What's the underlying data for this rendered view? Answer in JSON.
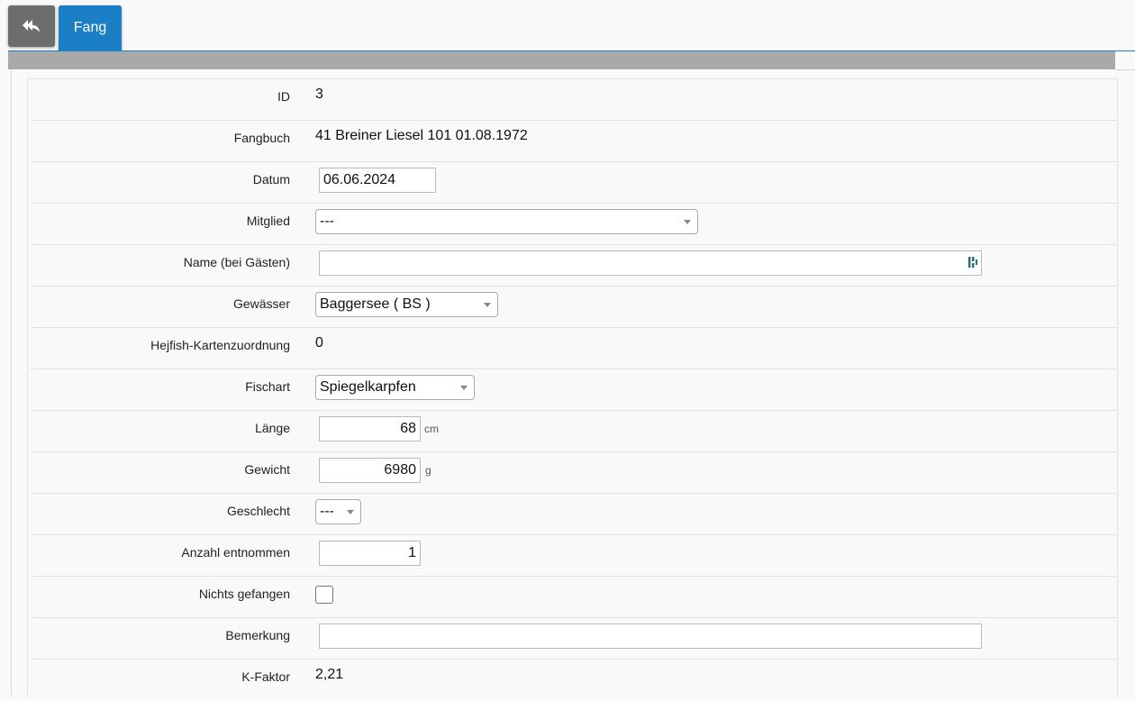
{
  "header": {
    "back_icon": "reply-arrow-icon",
    "tab_label": "Fang"
  },
  "form": {
    "id": {
      "label": "ID",
      "value": "3"
    },
    "fangbuch": {
      "label": "Fangbuch",
      "value": "41 Breiner Liesel 101 01.08.1972"
    },
    "datum": {
      "label": "Datum",
      "value": "06.06.2024"
    },
    "mitglied": {
      "label": "Mitglied",
      "value": "---"
    },
    "name": {
      "label": "Name (bei Gästen)",
      "value": ""
    },
    "gewaesser": {
      "label": "Gewässer",
      "value": "Baggersee ( BS )"
    },
    "hejfish": {
      "label": "Hejfish-Kartenzuordnung",
      "value": "0"
    },
    "fischart": {
      "label": "Fischart",
      "value": "Spiegelkarpfen"
    },
    "laenge": {
      "label": "Länge",
      "value": "68",
      "unit": "cm"
    },
    "gewicht": {
      "label": "Gewicht",
      "value": "6980",
      "unit": "g"
    },
    "geschlecht": {
      "label": "Geschlecht",
      "value": "---"
    },
    "anzahl": {
      "label": "Anzahl entnommen",
      "value": "1"
    },
    "nichts": {
      "label": "Nichts gefangen",
      "checked": false
    },
    "bemerkung": {
      "label": "Bemerkung",
      "value": ""
    },
    "kfaktor": {
      "label": "K-Faktor",
      "value": "2,21"
    }
  },
  "colors": {
    "accent": "#1a7fc4",
    "back_button": "#6d6d6d",
    "bar": "#a9a9a9"
  }
}
